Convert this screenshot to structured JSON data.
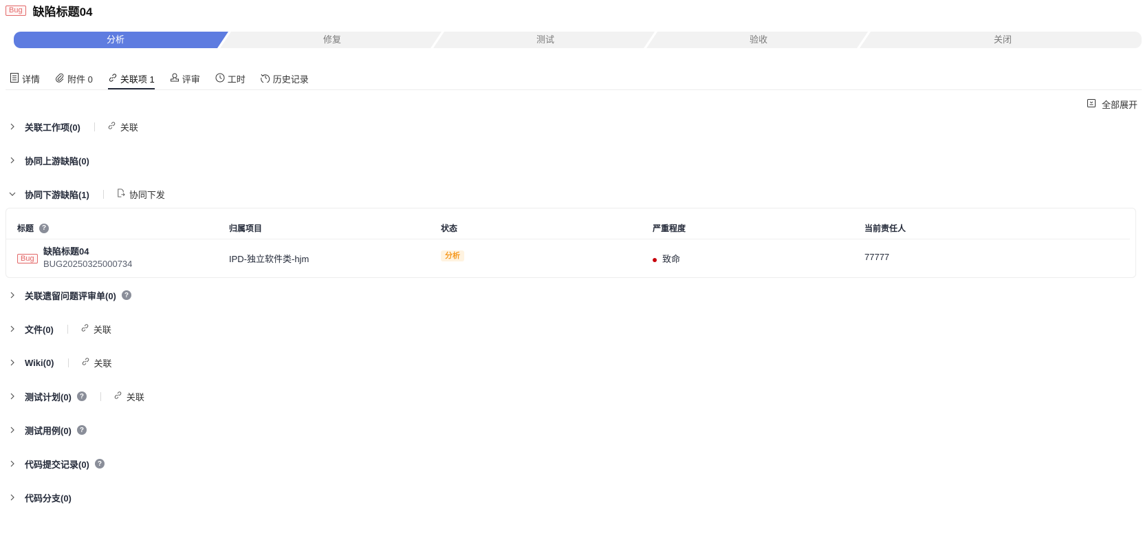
{
  "header": {
    "tag": "Bug",
    "title": "缺陷标题04"
  },
  "stepper": [
    "分析",
    "修复",
    "测试",
    "验收",
    "关闭"
  ],
  "tabs": [
    {
      "label": "详情",
      "icon": "details-icon"
    },
    {
      "label": "附件 0",
      "icon": "paperclip-icon"
    },
    {
      "label": "关联项 1",
      "icon": "link-icon"
    },
    {
      "label": "评审",
      "icon": "stamp-icon"
    },
    {
      "label": "工时",
      "icon": "clock-icon"
    },
    {
      "label": "历史记录",
      "icon": "history-icon"
    }
  ],
  "expand_all": "全部展开",
  "sections": [
    {
      "title": "关联工作项(0)",
      "action": "关联"
    },
    {
      "title": "协同上游缺陷(0)"
    },
    {
      "title": "协同下游缺陷(1)",
      "action": "协同下发"
    },
    {
      "title": "关联遗留问题评审单(0)",
      "help": "?"
    },
    {
      "title": "文件(0)",
      "action": "关联"
    },
    {
      "title": "Wiki(0)",
      "action": "关联"
    },
    {
      "title": "测试计划(0)",
      "help": "?",
      "action": "关联"
    },
    {
      "title": "测试用例(0)",
      "help": "?"
    },
    {
      "title": "代码提交记录(0)",
      "help": "?"
    },
    {
      "title": "代码分支(0)"
    }
  ],
  "table": {
    "headers": [
      "标题",
      "归属项目",
      "状态",
      "严重程度",
      "当前责任人"
    ],
    "help": "?",
    "row": {
      "tag": "Bug",
      "title": "缺陷标题04",
      "id": "BUG20250325000734",
      "project": "IPD-独立软件类-hjm",
      "status": "分析",
      "severity": "致命",
      "owner": "77777"
    }
  },
  "colors": {
    "accent": "#5e7ce0",
    "fatal": "#c7000b",
    "status_analyze": "#f59a23"
  }
}
